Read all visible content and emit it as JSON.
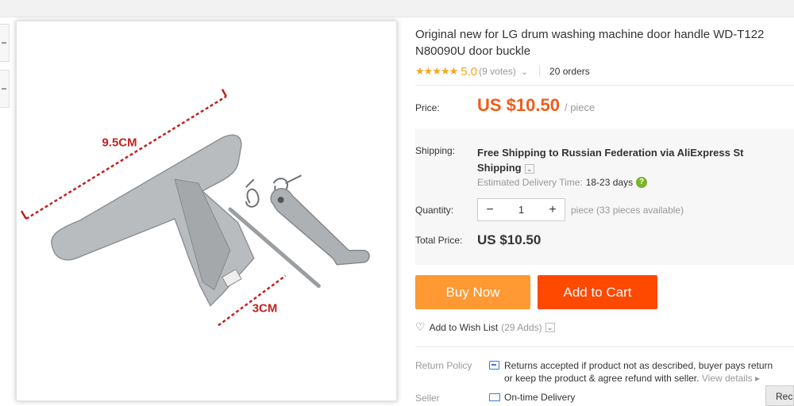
{
  "product": {
    "title_line1": "Original new for LG drum washing machine door handle WD-T122",
    "title_line2": "N80090U door buckle",
    "image_labels": {
      "width": "9.5CM",
      "depth": "3CM"
    }
  },
  "rating": {
    "stars": "★★★★★",
    "score": "5.0",
    "votes": "(9 votes)",
    "chevron": "⌄",
    "orders": "20 orders"
  },
  "price": {
    "label": "Price:",
    "value": "US $10.50",
    "unit": "/ piece"
  },
  "shipping": {
    "label": "Shipping:",
    "text_prefix": "Free Shipping to",
    "destination": "Russian Federation via AliExpress St",
    "line2": "Shipping",
    "chevron": "⌄",
    "estimate_label": "Estimated Delivery Time:",
    "estimate_days": "18-23 days",
    "help": "?"
  },
  "quantity": {
    "label": "Quantity:",
    "minus": "−",
    "value": "1",
    "plus": "+",
    "available": "piece (33 pieces available)"
  },
  "total": {
    "label": "Total Price:",
    "value": "US $10.50"
  },
  "actions": {
    "buy_now": "Buy Now",
    "add_to_cart": "Add to Cart"
  },
  "wishlist": {
    "heart": "♡",
    "label": "Add to Wish List",
    "count": "(29 Adds)",
    "chevron": "⌄"
  },
  "return_policy": {
    "label": "Return Policy",
    "line1": "Returns accepted if product not as described, buyer pays return",
    "line2": "or keep the product & agree refund with seller.",
    "view_details": "View details ▸"
  },
  "seller": {
    "label": "Seller",
    "text": "On-time Delivery"
  },
  "recommend_tab": "Rec",
  "colors": {
    "price": "#f25c19",
    "buy_now": "#ff9933",
    "add_to_cart": "#ff4800",
    "stars": "#f5a623",
    "help": "#7ab32e",
    "policy_icon": "#3a7bd5"
  }
}
